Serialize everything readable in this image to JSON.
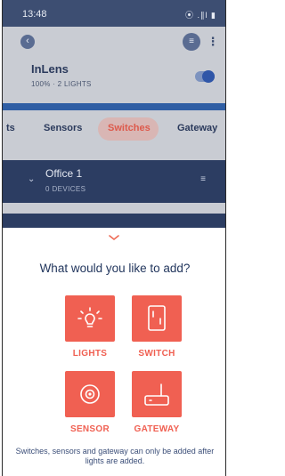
{
  "status_bar": {
    "time": "13:48",
    "icons": "⦿ .∥l ▮"
  },
  "top_bar": {
    "back_glyph": "‹",
    "tune_glyph": "≡",
    "more_glyph": "⋮"
  },
  "room": {
    "name": "InLens",
    "meta": "100% · 2 LIGHTS",
    "toggle_on": true
  },
  "tabs": [
    {
      "label": "ts"
    },
    {
      "label": "Sensors"
    },
    {
      "label": "Switches",
      "active": true
    },
    {
      "label": "Gateway"
    }
  ],
  "group": {
    "name": "Office 1",
    "meta": "0 DEVICES"
  },
  "sheet": {
    "chevron": "ˇ",
    "title": "What would you like to add?",
    "options": [
      {
        "label": "LIGHTS",
        "icon": "bulb-icon"
      },
      {
        "label": "SWITCH",
        "icon": "switch-icon"
      },
      {
        "label": "SENSOR",
        "icon": "sensor-icon"
      },
      {
        "label": "GATEWAY",
        "icon": "gateway-icon"
      }
    ],
    "note": "Switches, sensors and gateway can only be added after lights are added."
  },
  "colors": {
    "accent": "#f06052",
    "navy": "#23375e"
  }
}
